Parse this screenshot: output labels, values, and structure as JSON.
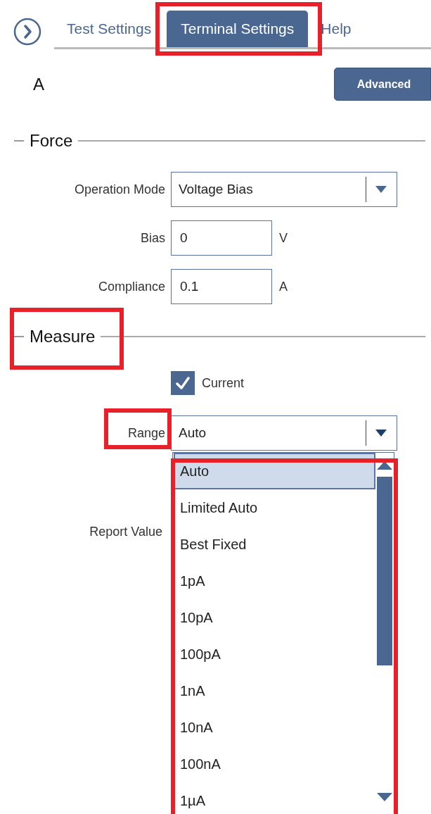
{
  "nav": {
    "tabs": [
      {
        "label": "Test Settings",
        "selected": false,
        "highlighted": false
      },
      {
        "label": "Terminal Settings",
        "selected": true,
        "highlighted": true
      },
      {
        "label": "Help",
        "selected": false,
        "highlighted": false
      }
    ]
  },
  "terminal": {
    "name": "A",
    "advanced_button": "Advanced"
  },
  "force": {
    "title": "Force",
    "fields": [
      {
        "kind": "select",
        "label": "Operation Mode",
        "value": "Voltage Bias"
      },
      {
        "kind": "input",
        "label": "Bias",
        "value": "0",
        "unit": "V"
      },
      {
        "kind": "input",
        "label": "Compliance",
        "value": "0.1",
        "unit": "A"
      }
    ]
  },
  "measure": {
    "title": "Measure",
    "highlighted": true,
    "current": {
      "label": "Current",
      "checked": true
    },
    "range": {
      "label": "Range",
      "value": "Auto",
      "highlighted": true
    },
    "report_value": {
      "label": "Report Value"
    }
  },
  "range_dropdown": {
    "highlighted": true,
    "options": [
      {
        "label": "Auto",
        "selected": true
      },
      {
        "label": "Limited Auto",
        "selected": false
      },
      {
        "label": "Best Fixed",
        "selected": false
      },
      {
        "label": "1pA",
        "selected": false
      },
      {
        "label": "10pA",
        "selected": false
      },
      {
        "label": "100pA",
        "selected": false
      },
      {
        "label": "1nA",
        "selected": false
      },
      {
        "label": "10nA",
        "selected": false
      },
      {
        "label": "100nA",
        "selected": false
      },
      {
        "label": "1µA",
        "selected": false
      }
    ]
  }
}
